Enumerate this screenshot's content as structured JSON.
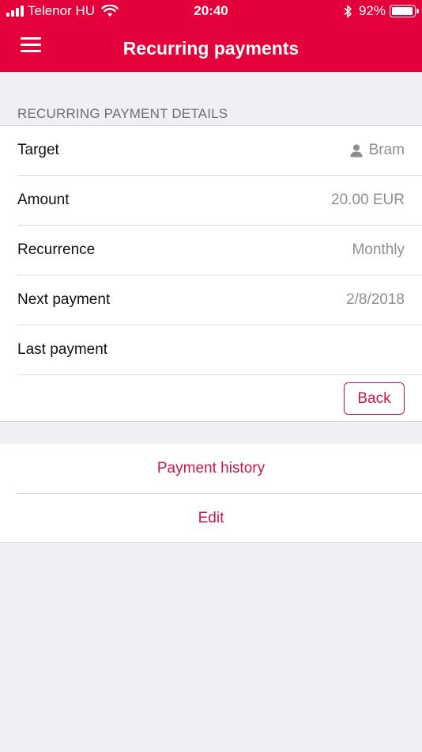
{
  "status_bar": {
    "carrier": "Telenor HU",
    "time": "20:40",
    "battery_percent": "92%"
  },
  "nav": {
    "title": "Recurring payments",
    "menu_icon": "hamburger-menu-icon"
  },
  "details": {
    "section_title": "RECURRING PAYMENT DETAILS",
    "rows": [
      {
        "label": "Target",
        "value": "Bram",
        "icon": "person-icon"
      },
      {
        "label": "Amount",
        "value": "20.00 EUR"
      },
      {
        "label": "Recurrence",
        "value": "Monthly"
      },
      {
        "label": "Next payment",
        "value": "2/8/2018"
      },
      {
        "label": "Last payment",
        "value": ""
      }
    ],
    "back_label": "Back"
  },
  "actions": {
    "payment_history": "Payment history",
    "edit": "Edit"
  },
  "colors": {
    "brand_red": "#e4003a",
    "accent": "#c8174a",
    "background": "#efeff4"
  }
}
